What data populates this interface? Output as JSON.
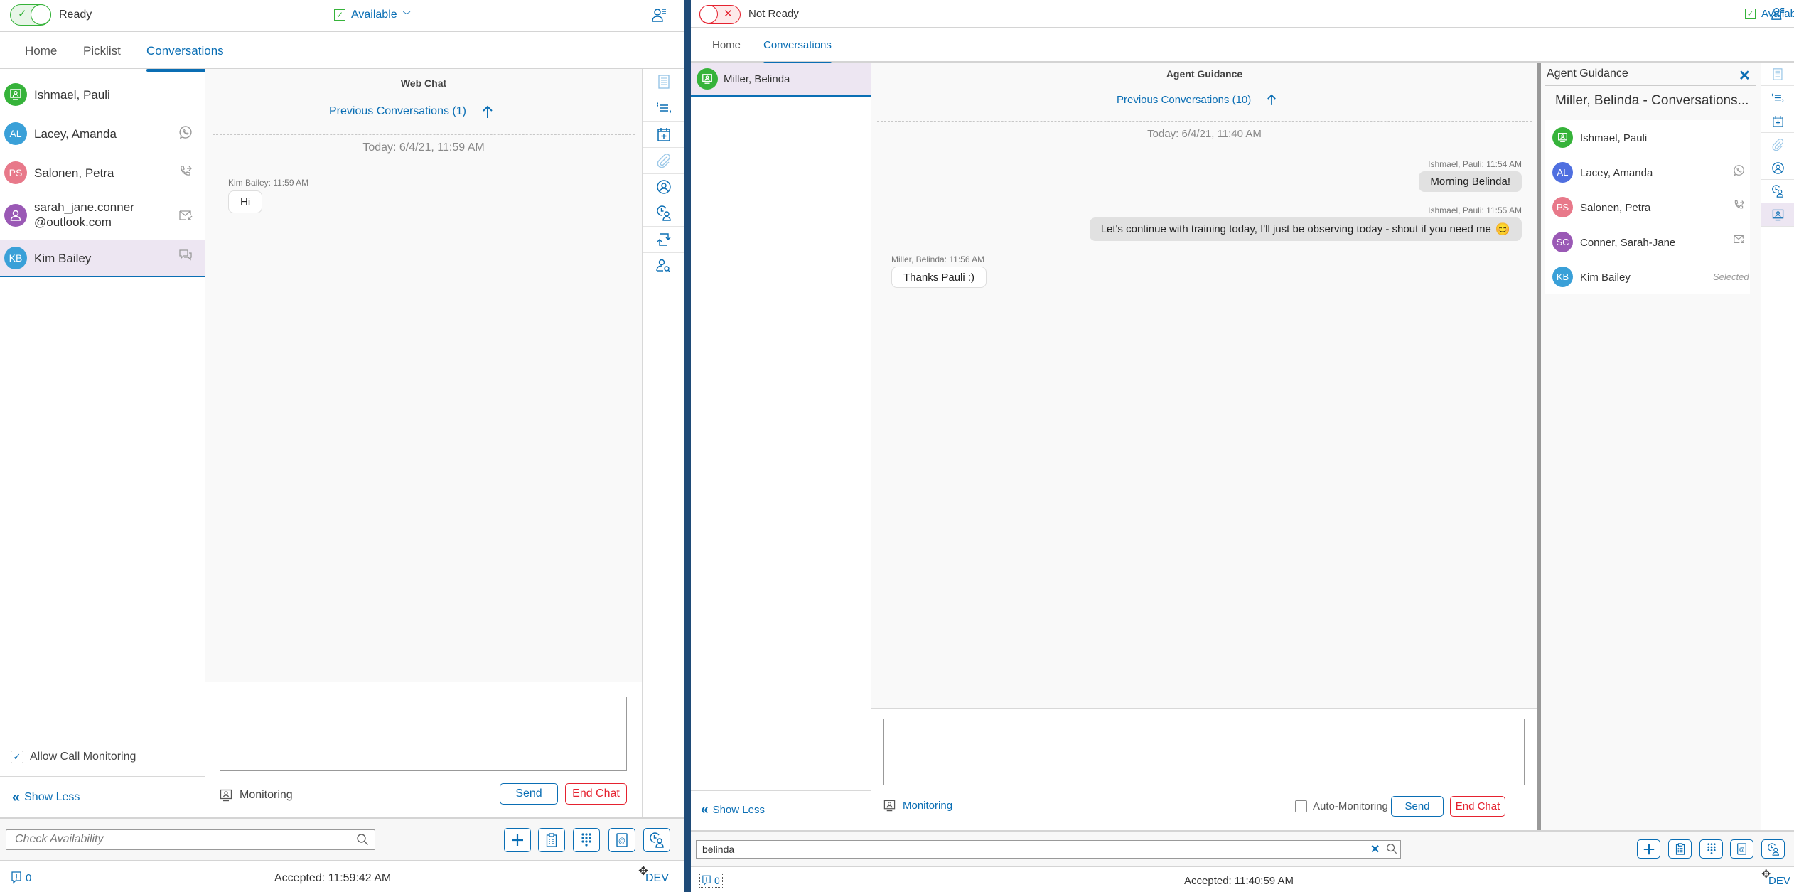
{
  "left_app": {
    "header": {
      "state_label": "Ready",
      "availability": "Available"
    },
    "tabs": [
      {
        "label": "Home",
        "active": false
      },
      {
        "label": "Picklist",
        "active": false
      },
      {
        "label": "Conversations",
        "active": true
      }
    ],
    "conversations": [
      {
        "name": "Ishmael, Pauli",
        "initials": "",
        "avatar_color": "#36b33a",
        "avatar_icon": "monitor-user-icon",
        "channel_icon": ""
      },
      {
        "name": "Lacey, Amanda",
        "initials": "AL",
        "avatar_color": "#3aa0d8",
        "channel_icon": "viber-call-icon"
      },
      {
        "name": "Salonen, Petra",
        "initials": "PS",
        "avatar_color": "#e8798a",
        "channel_icon": "phone-outgoing-icon"
      },
      {
        "name_line1": "sarah_jane.conner",
        "name_line2": "@outlook.com",
        "initials": "",
        "avatar_color": "#9a59b5",
        "avatar_icon": "user-icon",
        "channel_icon": "email-incoming-icon"
      },
      {
        "name": "Kim Bailey",
        "initials": "KB",
        "avatar_color": "#3aa0d8",
        "channel_icon": "chat-icon",
        "selected": true
      }
    ],
    "allow_call_monitoring": {
      "label": "Allow Call Monitoring",
      "checked": true
    },
    "show_less": "Show Less",
    "chat": {
      "title": "Web Chat",
      "previous_conversations": "Previous Conversations (1)",
      "date_divider": "Today: 6/4/21, 11:59 AM",
      "messages": [
        {
          "sender_meta": "Kim Bailey: 11:59 AM",
          "text": "Hi",
          "side": "left"
        }
      ],
      "input_value": "",
      "monitoring_label": "Monitoring",
      "send_label": "Send",
      "end_chat_label": "End Chat"
    },
    "rail_icons": [
      "notes-icon",
      "script-icon",
      "calendar-add-icon",
      "attachment-icon",
      "contact-icon",
      "history-user-icon",
      "transfer-icon",
      "user-search-icon"
    ],
    "bottom": {
      "search_placeholder": "Check Availability",
      "search_value": "",
      "action_icons": [
        "add-icon",
        "clipboard-icon",
        "dialpad-icon",
        "address-book-icon",
        "history-user-icon"
      ]
    },
    "footer": {
      "alerts_count": "0",
      "status": "Accepted: 11:59:42 AM",
      "env": "DEV"
    }
  },
  "right_app": {
    "header": {
      "state_label": "Not Ready",
      "availability": "Available"
    },
    "tabs": [
      {
        "label": "Home",
        "active": false
      },
      {
        "label": "Conversations",
        "active": true
      }
    ],
    "conversations": [
      {
        "name": "Miller, Belinda",
        "avatar_color": "#36b33a",
        "avatar_icon": "monitor-user-icon",
        "selected": true
      }
    ],
    "show_less": "Show Less",
    "chat": {
      "title": "Agent Guidance",
      "previous_conversations": "Previous Conversations (10)",
      "date_divider": "Today: 6/4/21, 11:40 AM",
      "messages": [
        {
          "sender_meta": "Ishmael, Pauli: 11:54 AM",
          "text": "Morning Belinda!",
          "side": "right"
        },
        {
          "sender_meta": "Ishmael, Pauli: 11:55 AM",
          "text": "Let's continue with training today, I'll just be observing today - shout if you need me",
          "emoji": "😊",
          "side": "right"
        },
        {
          "sender_meta": "Miller, Belinda: 11:56 AM",
          "text": "Thanks Pauli :)",
          "side": "left"
        }
      ],
      "input_value": "",
      "monitoring_label": "Monitoring",
      "auto_monitoring": {
        "label": "Auto-Monitoring",
        "checked": false
      },
      "send_label": "Send",
      "end_chat_label": "End Chat"
    },
    "guidance_panel": {
      "title": "Agent Guidance",
      "subtitle": "Miller, Belinda - Conversations...",
      "items": [
        {
          "name": "Ishmael, Pauli",
          "avatar_color": "#36b33a",
          "avatar_icon": "monitor-user-icon",
          "channel_icon": "",
          "status": ""
        },
        {
          "name": "Lacey, Amanda",
          "initials": "AL",
          "avatar_color": "#4f6fe0",
          "channel_icon": "viber-call-icon",
          "status": ""
        },
        {
          "name": "Salonen, Petra",
          "initials": "PS",
          "avatar_color": "#e8798a",
          "channel_icon": "phone-outgoing-icon",
          "status": ""
        },
        {
          "name": "Conner, Sarah-Jane",
          "initials": "SC",
          "avatar_color": "#9a59b5",
          "channel_icon": "email-incoming-icon",
          "status": ""
        },
        {
          "name": "Kim Bailey",
          "initials": "KB",
          "avatar_color": "#3aa0d8",
          "channel_icon": "",
          "status": "Selected"
        }
      ]
    },
    "rail_icons": [
      "notes-icon",
      "script-icon",
      "calendar-add-icon",
      "attachment-icon",
      "contact-icon",
      "history-user-icon",
      "agent-guidance-icon"
    ],
    "bottom": {
      "search_value": "belinda",
      "action_icons": [
        "add-icon",
        "clipboard-icon",
        "dialpad-icon",
        "address-book-icon",
        "history-user-icon"
      ]
    },
    "footer": {
      "alerts_count": "0",
      "status": "Accepted: 11:40:59 AM",
      "env": "DEV"
    }
  }
}
